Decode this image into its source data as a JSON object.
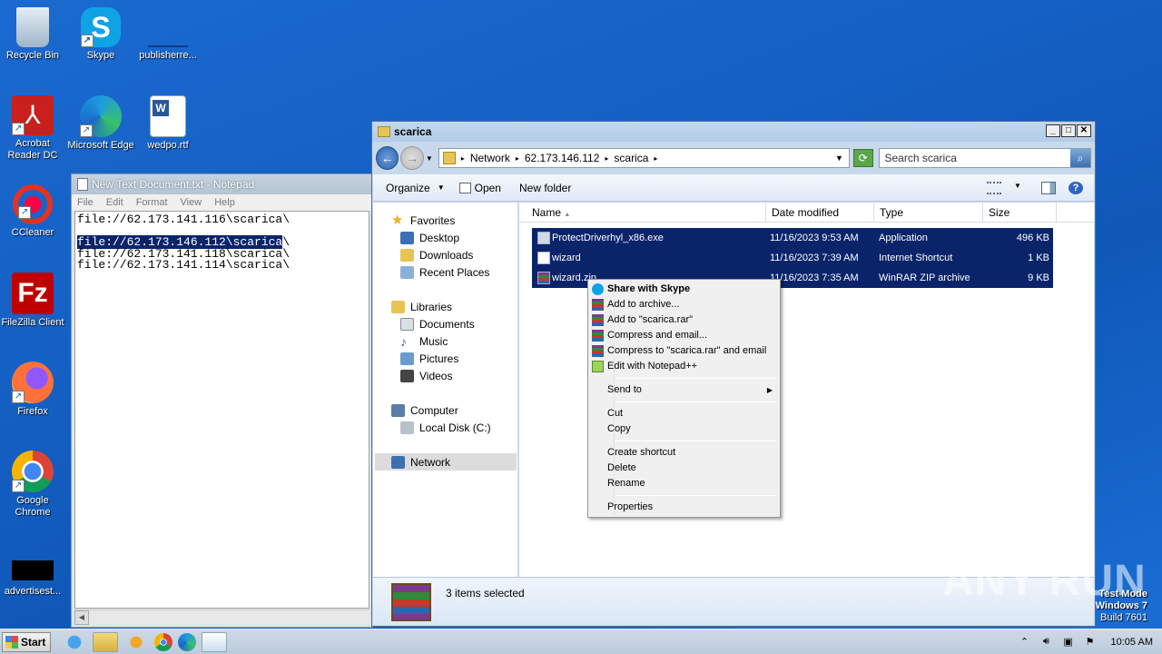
{
  "desktop": {
    "icons": [
      {
        "label": "Recycle Bin",
        "icon": "recycle-bin-icon"
      },
      {
        "label": "Skype",
        "icon": "skype-icon"
      },
      {
        "label": "publisherre...",
        "icon": "blank-file-icon"
      },
      {
        "label": "Acrobat Reader DC",
        "icon": "acrobat-icon"
      },
      {
        "label": "Microsoft Edge",
        "icon": "edge-icon"
      },
      {
        "label": "wedpo.rtf",
        "icon": "word-document-icon"
      },
      {
        "label": "CCleaner",
        "icon": "ccleaner-icon"
      },
      {
        "label": "FileZilla Client",
        "icon": "filezilla-icon"
      },
      {
        "label": "Firefox",
        "icon": "firefox-icon"
      },
      {
        "label": "Google Chrome",
        "icon": "chrome-icon"
      },
      {
        "label": "advertisest...",
        "icon": "blank-file-icon"
      }
    ]
  },
  "notepad": {
    "title": "New Text Document.txt - Notepad",
    "menu": [
      "File",
      "Edit",
      "Format",
      "View",
      "Help"
    ],
    "lines": [
      "file://62.173.141.116\\scarica\\",
      "",
      "file://62.173.146.112\\scarica",
      "file://62.173.141.118\\scarica\\",
      "file://62.173.141.114\\scarica\\"
    ],
    "selected_line_suffix": "\\"
  },
  "explorer": {
    "title": "scarica",
    "breadcrumb": [
      "Network",
      "62.173.146.112",
      "scarica"
    ],
    "search_placeholder": "Search scarica",
    "toolbar": {
      "organize": "Organize",
      "open": "Open",
      "new_folder": "New folder"
    },
    "nav": {
      "favorites": "Favorites",
      "desktop": "Desktop",
      "downloads": "Downloads",
      "recent": "Recent Places",
      "libraries": "Libraries",
      "documents": "Documents",
      "music": "Music",
      "pictures": "Pictures",
      "videos": "Videos",
      "computer": "Computer",
      "local_disk": "Local Disk (C:)",
      "network": "Network"
    },
    "columns": {
      "name": "Name",
      "date": "Date modified",
      "type": "Type",
      "size": "Size"
    },
    "files": [
      {
        "name": "ProtectDriverhyl_x86.exe",
        "date": "11/16/2023 9:53 AM",
        "type": "Application",
        "size": "496 KB"
      },
      {
        "name": "wizard",
        "date": "11/16/2023 7:39 AM",
        "type": "Internet Shortcut",
        "size": "1 KB"
      },
      {
        "name": "wizard.zip",
        "date": "11/16/2023 7:35 AM",
        "type": "WinRAR ZIP archive",
        "size": "9 KB"
      }
    ],
    "status": "3 items selected"
  },
  "context_menu": {
    "share_skype": "Share with Skype",
    "add_archive": "Add to archive...",
    "add_rar": "Add to \"scarica.rar\"",
    "compress_email": "Compress and email...",
    "compress_rar_email": "Compress to \"scarica.rar\" and email",
    "edit_notepadpp": "Edit with Notepad++",
    "send_to": "Send to",
    "cut": "Cut",
    "copy": "Copy",
    "create_shortcut": "Create shortcut",
    "delete": "Delete",
    "rename": "Rename",
    "properties": "Properties"
  },
  "taskbar": {
    "start": "Start",
    "clock": "10:05 AM"
  },
  "watermark": {
    "line1": "Test Mode",
    "line2": "Windows 7",
    "line3": "Build 7601",
    "brand": "ANY RUN"
  },
  "colors": {
    "desktop_bg": "#1560c4",
    "selection": "#0a246a"
  }
}
